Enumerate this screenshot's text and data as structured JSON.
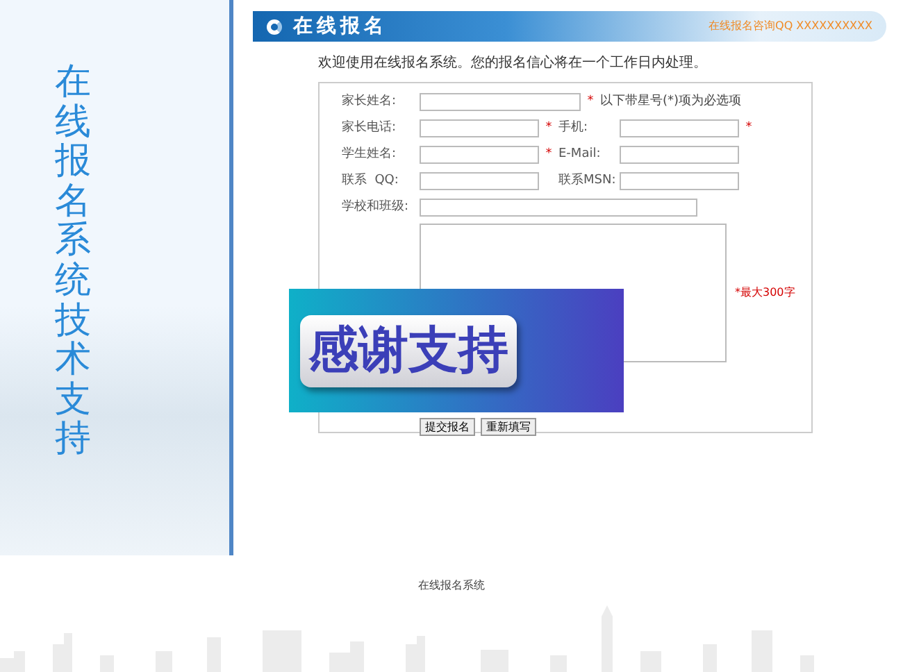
{
  "sidebar": {
    "title": "在线报名系统技术支持"
  },
  "header": {
    "title": "在线报名",
    "hotline": "在线报名咨询QQ XXXXXXXXXX"
  },
  "intro": "欢迎使用在线报名系统。您的报名信心将在一个工作日内处理。",
  "form": {
    "rows": [
      {
        "fields": [
          {
            "label": "家长姓名:",
            "mark": "*"
          }
        ],
        "note": "以下带星号(*)项为必选项"
      },
      {
        "fields": [
          {
            "label": "家长电话:",
            "mark": "*"
          },
          {
            "label": "手机:",
            "mark": "*"
          }
        ]
      },
      {
        "fields": [
          {
            "label": "学生姓名:",
            "mark": "*"
          },
          {
            "label": "E-Mail:"
          }
        ]
      },
      {
        "fields": [
          {
            "label": "联系  QQ:"
          },
          {
            "label": "联系MSN:"
          }
        ]
      },
      {
        "fields": [
          {
            "label": "学校和班级:"
          }
        ]
      }
    ],
    "textarea_note": "*最大300字",
    "buttons": [
      "提交报名",
      "重新填写"
    ]
  },
  "banner": {
    "text": "感谢支持"
  },
  "footer": "在线报名系统"
}
